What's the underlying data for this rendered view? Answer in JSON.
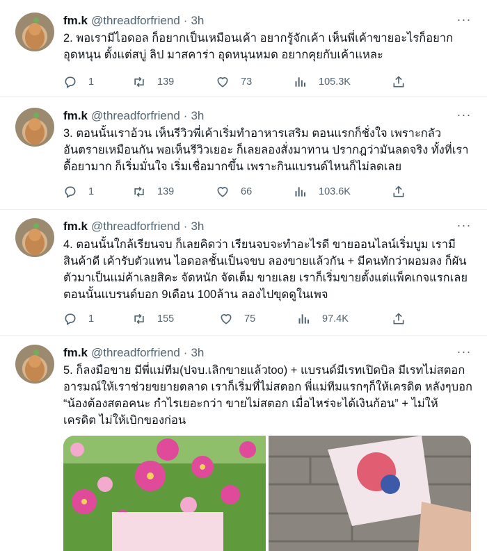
{
  "tweets": [
    {
      "name": "fm.k",
      "handle": "@threadforfriend",
      "separator": "·",
      "time": "3h",
      "lines": [
        "2. พอเรามีไอดอล ก็อยากเป็นเหมือนเค้า อยากรู้จักเค้า เห็นพี่เค้าขายอะไรก็อยาก",
        "อุดหนุน ตั้งแต่สบู่ ลิป มาสคาร่า อุดหนุนหมด อยากคุยกับเค้าแหละ"
      ],
      "replies": "1",
      "retweets": "139",
      "likes": "73",
      "views": "105.3K"
    },
    {
      "name": "fm.k",
      "handle": "@threadforfriend",
      "separator": "·",
      "time": "3h",
      "lines": [
        "3. ตอนนั้นเราอ้วน เห็นรีวิวพี่เค้าเริ่มทำอาหารเสริม ตอนแรกก็ชั่งใจ เพราะกลัว",
        "อันตรายเหมือนกัน พอเห็นรีวิวเยอะ ก็เลยลองสั่งมาทาน ปรากฎว่ามันลดจริง ทั้งที่เรา",
        "ดื้อยามาก ก็เริ่มมั่นใจ เริ่มเชื่อมากขึ้น เพราะกินแบรนด์ไหนก็ไม่ลดเลย"
      ],
      "replies": "1",
      "retweets": "139",
      "likes": "66",
      "views": "103.6K"
    },
    {
      "name": "fm.k",
      "handle": "@threadforfriend",
      "separator": "·",
      "time": "3h",
      "lines": [
        "4. ตอนนั้นใกล้เรียนจบ ก็เลยคิดว่า เรียนจบจะทำอะไรดี ขายออนไลน์เริ่มบูม เรามี",
        "สินค้าดี เค้ารับตัวแทน ไอดอลชั้นเป็นจขบ ลองขายแล้วกัน + มีคนทักว่าผอมลง ก็ผัน",
        "ตัวมาเป็นแม่ค้าเลยสิคะ จัดหนัก จัดเต็ม ขายเลย เราก็เริ่มขายตั้งแต่แพ็คเกจแรกเลย",
        "ตอนนั้นแบรนด์บอก 9เดือน 100ล้าน ลองไปขุดดูในเพจ"
      ],
      "replies": "1",
      "retweets": "155",
      "likes": "75",
      "views": "97.4K"
    },
    {
      "name": "fm.k",
      "handle": "@threadforfriend",
      "separator": "·",
      "time": "3h",
      "lines": [
        "5. ก็ลงมือขาย มีพี่แม่ทีม(ปจบ.เลิกขายแล้วtoo) + แบรนด์มีเรทเปิดบิล มีเรทไม่สตอก",
        "อารมณ์ให้เราช่วยขยายตลาด เราก็เริ่มที่ไม่สตอก พี่แม่ทีมแรกๆก็ให้เครดิต หลังๆบอก",
        "“น้องต้องสตอคนะ กำไรเยอะกว่า ขายไม่สตอก เมื่อไหร่จะได้เงินก้อน” + ไม่ให้",
        "เครดิต ไม่ให้เบิกของก่อน"
      ]
    }
  ],
  "icons": {
    "more": "more-horizontal-icon",
    "reply": "reply-icon",
    "retweet": "retweet-icon",
    "like": "heart-icon",
    "views": "views-chart-icon",
    "share": "share-icon"
  },
  "colors": {
    "text": "#0f1419",
    "secondary": "#536471",
    "divider": "#eff3f4"
  }
}
